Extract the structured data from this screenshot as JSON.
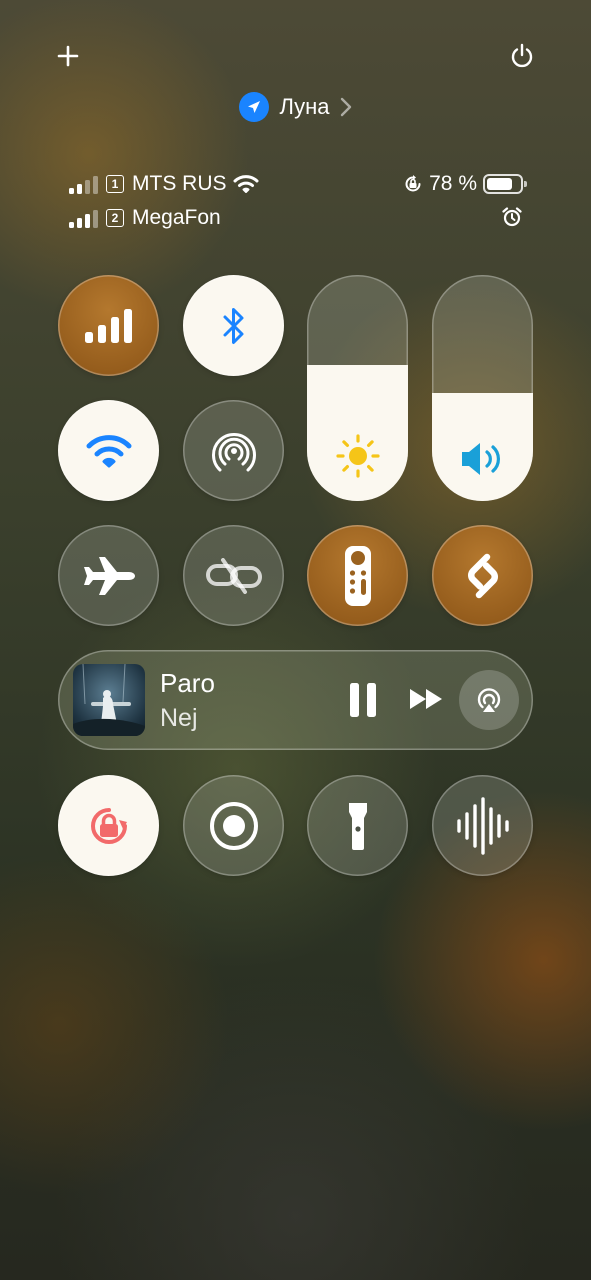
{
  "location": {
    "name": "Луна"
  },
  "status": {
    "sim1": {
      "slot": "1",
      "carrier": "MTS RUS"
    },
    "sim2": {
      "slot": "2",
      "carrier": "MegaFon"
    },
    "battery_text": "78 %",
    "battery_level": 0.78
  },
  "sliders": {
    "brightness_level": 0.6,
    "volume_level": 0.48
  },
  "media": {
    "title": "Paro",
    "artist": "Nej"
  },
  "icons": [
    "plus-icon",
    "power-icon",
    "location-arrow-icon",
    "chevron-right-icon",
    "signal-icon",
    "wifi-icon",
    "rotation-lock-icon",
    "battery-icon",
    "alarm-icon",
    "cellular-icon",
    "bluetooth-icon",
    "airdrop-icon",
    "brightness-icon",
    "volume-icon",
    "airplane-icon",
    "unlink-icon",
    "remote-icon",
    "shazam-icon",
    "pause-icon",
    "forward-icon",
    "airplay-icon",
    "screen-rotation-lock-icon",
    "screen-record-icon",
    "flashlight-icon",
    "voice-memo-icon"
  ],
  "colors": {
    "accent_blue": "#1a84ff",
    "active_tile": "#fbf8f0",
    "orange_tile": "#9a6220",
    "rotation_lock_red": "#f26a6a"
  }
}
